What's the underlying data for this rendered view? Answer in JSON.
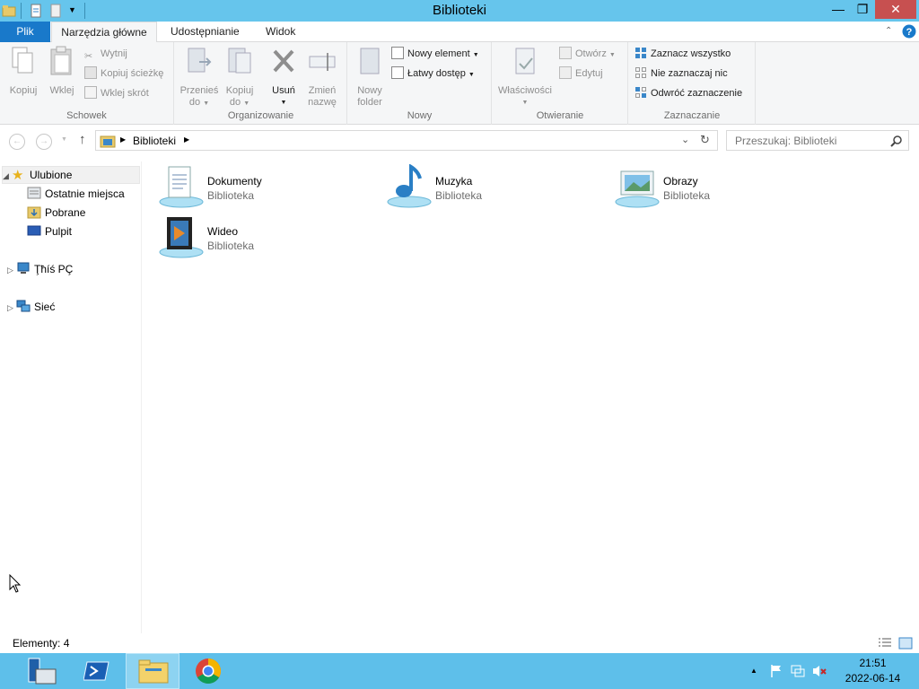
{
  "window": {
    "title": "Biblioteki",
    "controls": {
      "minimize": "—",
      "maximize": "❐",
      "close": "✕"
    }
  },
  "ribbon": {
    "tabs": [
      {
        "label": "Plik"
      },
      {
        "label": "Narzędzia główne"
      },
      {
        "label": "Udostępnianie"
      },
      {
        "label": "Widok"
      }
    ],
    "groups": {
      "clipboard": {
        "label": "Schowek",
        "copy": "Kopiuj",
        "paste": "Wklej",
        "cut": "Wytnij",
        "copy_path": "Kopiuj ścieżkę",
        "paste_shortcut": "Wklej skrót"
      },
      "organize": {
        "label": "Organizowanie",
        "move_to": [
          "Przenieś",
          "do"
        ],
        "copy_to": [
          "Kopiuj",
          "do"
        ],
        "delete": "Usuń",
        "rename": [
          "Zmień",
          "nazwę"
        ]
      },
      "new": {
        "label": "Nowy",
        "new_folder": [
          "Nowy",
          "folder"
        ],
        "new_item": "Nowy element",
        "easy_access": "Łatwy dostęp"
      },
      "open": {
        "label": "Otwieranie",
        "properties": "Właściwości",
        "open": "Otwórz",
        "edit": "Edytuj"
      },
      "select": {
        "label": "Zaznaczanie",
        "select_all": "Zaznacz wszystko",
        "select_none": "Nie zaznaczaj nic",
        "invert": "Odwróć zaznaczenie"
      }
    }
  },
  "address": {
    "crumb": "Biblioteki",
    "search_placeholder": "Przeszukaj: Biblioteki"
  },
  "nav": {
    "favorites": "Ulubione",
    "recent": "Ostatnie miejsca",
    "downloads": "Pobrane",
    "desktop": "Pulpit",
    "this_pc": "Ţħíś PÇ",
    "network": "Sieć"
  },
  "libraries": [
    {
      "name": "Dokumenty",
      "type": "Biblioteka",
      "icon": "documents-library-icon"
    },
    {
      "name": "Muzyka",
      "type": "Biblioteka",
      "icon": "music-library-icon"
    },
    {
      "name": "Obrazy",
      "type": "Biblioteka",
      "icon": "pictures-library-icon"
    },
    {
      "name": "Wideo",
      "type": "Biblioteka",
      "icon": "video-library-icon"
    }
  ],
  "status": {
    "count": "Elementy: 4"
  },
  "taskbar": {
    "time": "21:51",
    "date": "2022-06-14"
  },
  "colors": {
    "titlebar": "#66c5ec",
    "file_tab": "#1979ca",
    "taskbar": "#5ebfea",
    "close_button": "#c75050"
  }
}
